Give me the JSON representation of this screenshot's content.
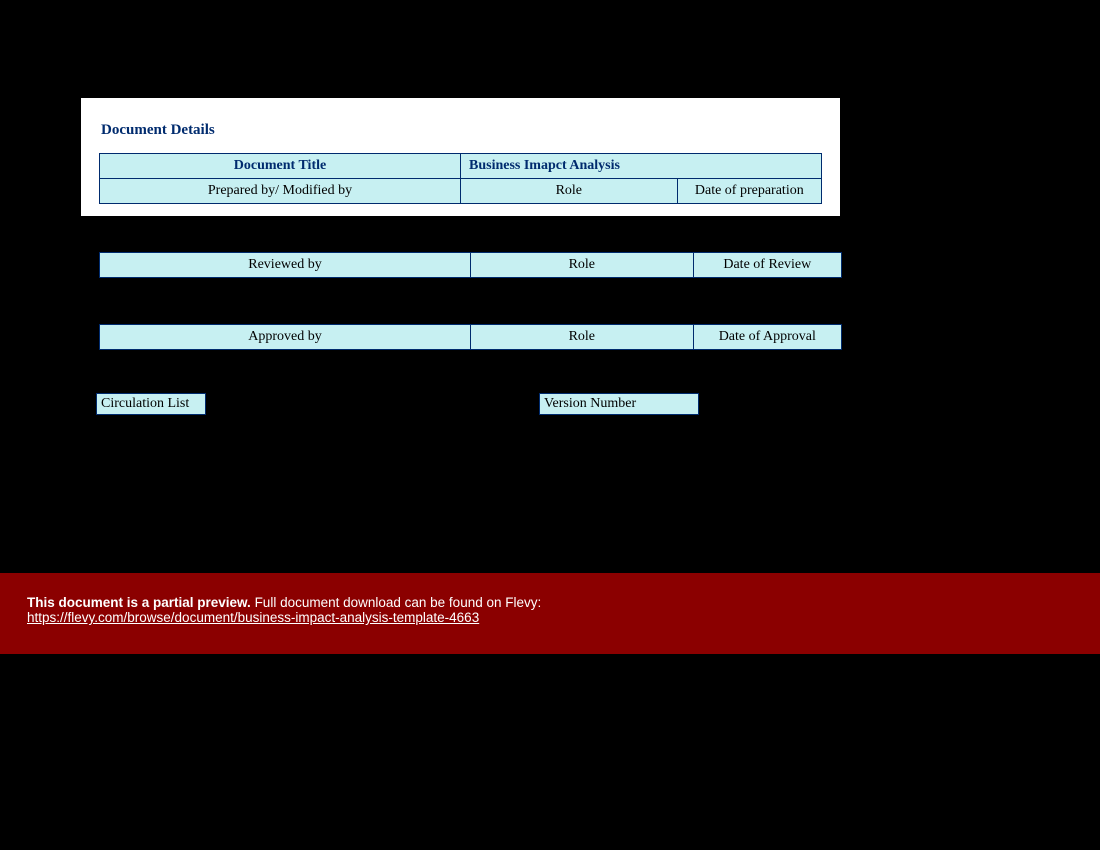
{
  "doc": {
    "heading": "Document Details",
    "title_label": "Document Title",
    "title_value": "Business Imapct Analysis",
    "rows": [
      {
        "c1": "Prepared by/ Modified by",
        "c2": "Role",
        "c3": "Date of preparation"
      },
      {
        "c1": "Reviewed by",
        "c2": "Role",
        "c3": "Date of Review"
      },
      {
        "c1": "Approved by",
        "c2": "Role",
        "c3": "Date of Approval"
      }
    ],
    "circulation_label": "Circulation List",
    "version_label": "Version Number"
  },
  "footer": {
    "bold": "This document is a partial preview.",
    "rest": "  Full document download can be found on Flevy:",
    "link": "https://flevy.com/browse/document/business-impact-analysis-template-4663"
  }
}
